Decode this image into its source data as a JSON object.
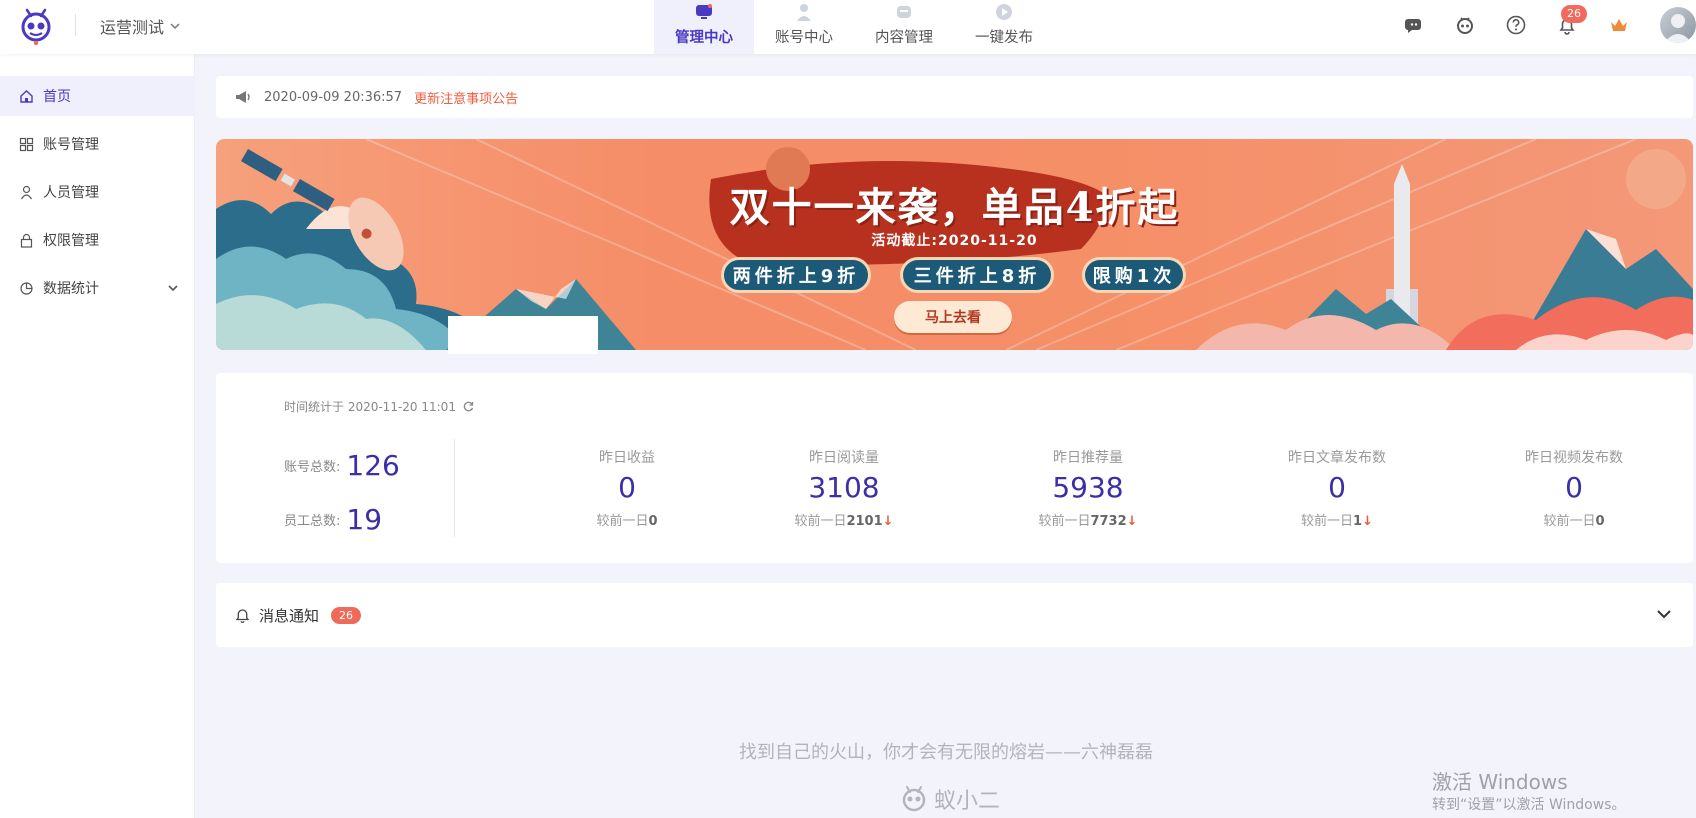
{
  "header": {
    "workspace": "运营测试",
    "tabs": [
      {
        "label": "管理中心",
        "active": true
      },
      {
        "label": "账号中心",
        "active": false
      },
      {
        "label": "内容管理",
        "active": false
      },
      {
        "label": "一键发布",
        "active": false
      }
    ],
    "notification_count": "26",
    "accent_color": "#4a3ac2"
  },
  "sidebar": {
    "items": [
      {
        "label": "首页",
        "icon": "home-icon",
        "active": true
      },
      {
        "label": "账号管理",
        "icon": "grid-icon",
        "active": false
      },
      {
        "label": "人员管理",
        "icon": "person-icon",
        "active": false
      },
      {
        "label": "权限管理",
        "icon": "lock-icon",
        "active": false
      },
      {
        "label": "数据统计",
        "icon": "pie-chart-icon",
        "active": false,
        "expandable": true
      }
    ]
  },
  "notice": {
    "time": "2020-09-09 20:36:57",
    "link": "更新注意事项公告"
  },
  "banner": {
    "title": "双十一来袭，单品4折起",
    "deadline": "活动截止:2020-11-20",
    "pills": [
      "两件折上9折",
      "三件折上8折",
      "限购1次"
    ],
    "cta": "马上去看"
  },
  "stats": {
    "timestamp": "时间统计于 2020-11-20 11:01",
    "accounts_label": "账号总数:",
    "accounts_value": "126",
    "staff_label": "员工总数:",
    "staff_value": "19",
    "compare_prefix": "较前一日",
    "metrics": [
      {
        "label": "昨日收益",
        "value": "0",
        "compare": "0",
        "down": false
      },
      {
        "label": "昨日阅读量",
        "value": "3108",
        "compare": "2101",
        "down": true
      },
      {
        "label": "昨日推荐量",
        "value": "5938",
        "compare": "7732",
        "down": true
      },
      {
        "label": "昨日文章发布数",
        "value": "0",
        "compare": "1",
        "down": true
      },
      {
        "label": "昨日视频发布数",
        "value": "0",
        "compare": "0",
        "down": false
      }
    ]
  },
  "messages": {
    "label": "消息通知",
    "count": "26"
  },
  "footer": {
    "quote": "找到自己的火山，你才会有无限的熔岩——六神磊磊",
    "brand": "蚁小二"
  },
  "windows_watermark": {
    "line1": "激活 Windows",
    "line2": "转到“设置”以激活 Windows。"
  }
}
